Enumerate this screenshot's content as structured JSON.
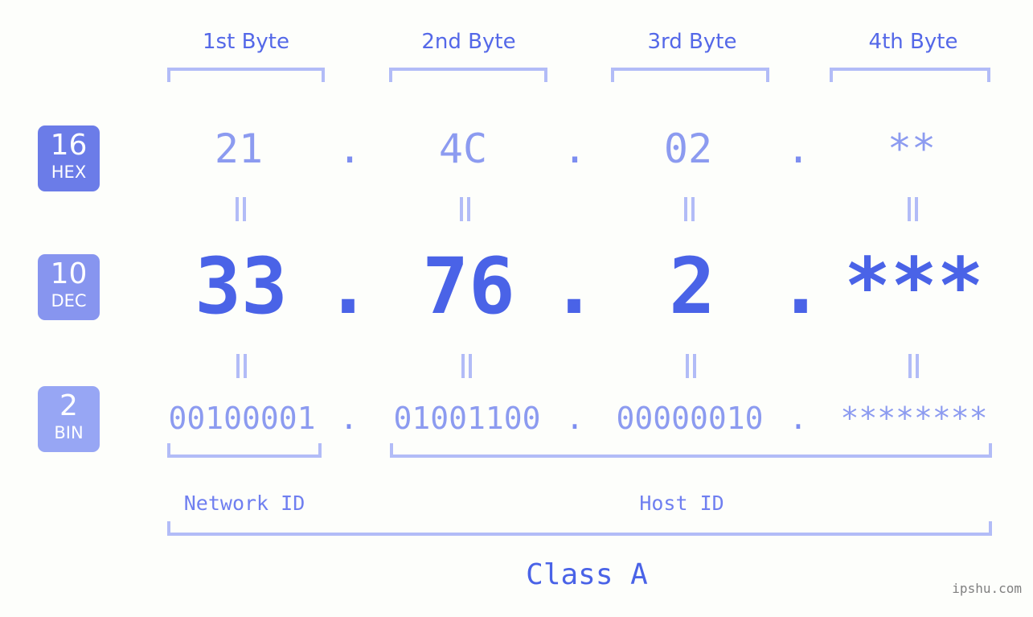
{
  "meta": {
    "background": "#fdfefb",
    "accent_strong": "#4a63e7",
    "accent_mid": "#5468e8",
    "accent_light": "#8c9bf0",
    "bracket_color": "#b2bcf7",
    "watermark": "ipshu.com"
  },
  "headers": [
    {
      "label": "1st Byte"
    },
    {
      "label": "2nd Byte"
    },
    {
      "label": "3rd Byte"
    },
    {
      "label": "4th Byte"
    }
  ],
  "bases": [
    {
      "number": "16",
      "name": "HEX",
      "color": "#6b7ce8"
    },
    {
      "number": "10",
      "name": "DEC",
      "color": "#8795ef"
    },
    {
      "number": "2",
      "name": "BIN",
      "color": "#97a6f4"
    }
  ],
  "rows": {
    "hex": {
      "base_number": "16",
      "base_name": "HEX",
      "values": [
        "21",
        "4C",
        "02",
        "**"
      ],
      "separator": "."
    },
    "dec": {
      "base_number": "10",
      "base_name": "DEC",
      "values": [
        "33",
        "76",
        "2",
        "***"
      ],
      "separator": "."
    },
    "bin": {
      "base_number": "2",
      "base_name": "BIN",
      "values": [
        "00100001",
        "01001100",
        "00000010",
        "********"
      ],
      "separator": "."
    }
  },
  "equals_marker": "=",
  "segments": {
    "network_id": "Network ID",
    "host_id": "Host ID"
  },
  "class": {
    "label": "Class A"
  }
}
